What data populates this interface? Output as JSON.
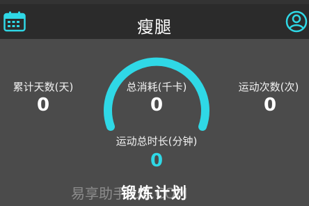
{
  "header": {
    "title": "瘦腿",
    "left_icon": "calendar-icon",
    "right_icon": "user-profile-icon"
  },
  "colors": {
    "accent": "#2fd8e6",
    "header_bg": "#2b2b2b",
    "body_bg": "#4b4b4b"
  },
  "stats": {
    "days": {
      "label": "累计天数(天)",
      "value": "0"
    },
    "calories": {
      "label": "总消耗(千卡)",
      "value": "0"
    },
    "count": {
      "label": "运动次数(次)",
      "value": "0"
    },
    "duration": {
      "label": "运动总时长(分钟)",
      "value": "0"
    }
  },
  "plan": {
    "title": "锻炼计划"
  },
  "watermark": "易享助手 UZ.COM"
}
